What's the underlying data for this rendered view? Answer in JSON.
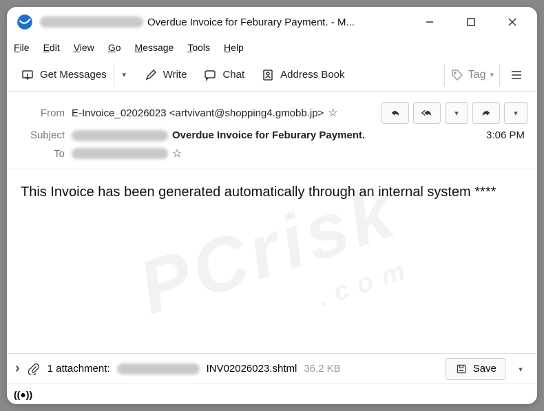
{
  "window": {
    "title": "Overdue Invoice for Feburary Payment. - M..."
  },
  "menu": {
    "file": "File",
    "edit": "Edit",
    "view": "View",
    "go": "Go",
    "message": "Message",
    "tools": "Tools",
    "help": "Help"
  },
  "toolbar": {
    "get_messages": "Get Messages",
    "write": "Write",
    "chat": "Chat",
    "address_book": "Address Book",
    "tag": "Tag"
  },
  "headers": {
    "from_label": "From",
    "from_value": "E-Invoice_02026023 <artvivant@shopping4.gmobb.jp>",
    "subject_label": "Subject",
    "subject_value": "Overdue Invoice for Feburary Payment.",
    "to_label": "To",
    "time": "3:06 PM"
  },
  "body": {
    "text": "This Invoice has been generated automatically through an internal system ****"
  },
  "attachment": {
    "expand": "›",
    "count_text": "1 attachment:",
    "filename": "INV02026023.shtml",
    "size": "36.2 KB",
    "save": "Save"
  },
  "watermark": {
    "main": "PCrisk",
    "sub": ".com"
  }
}
